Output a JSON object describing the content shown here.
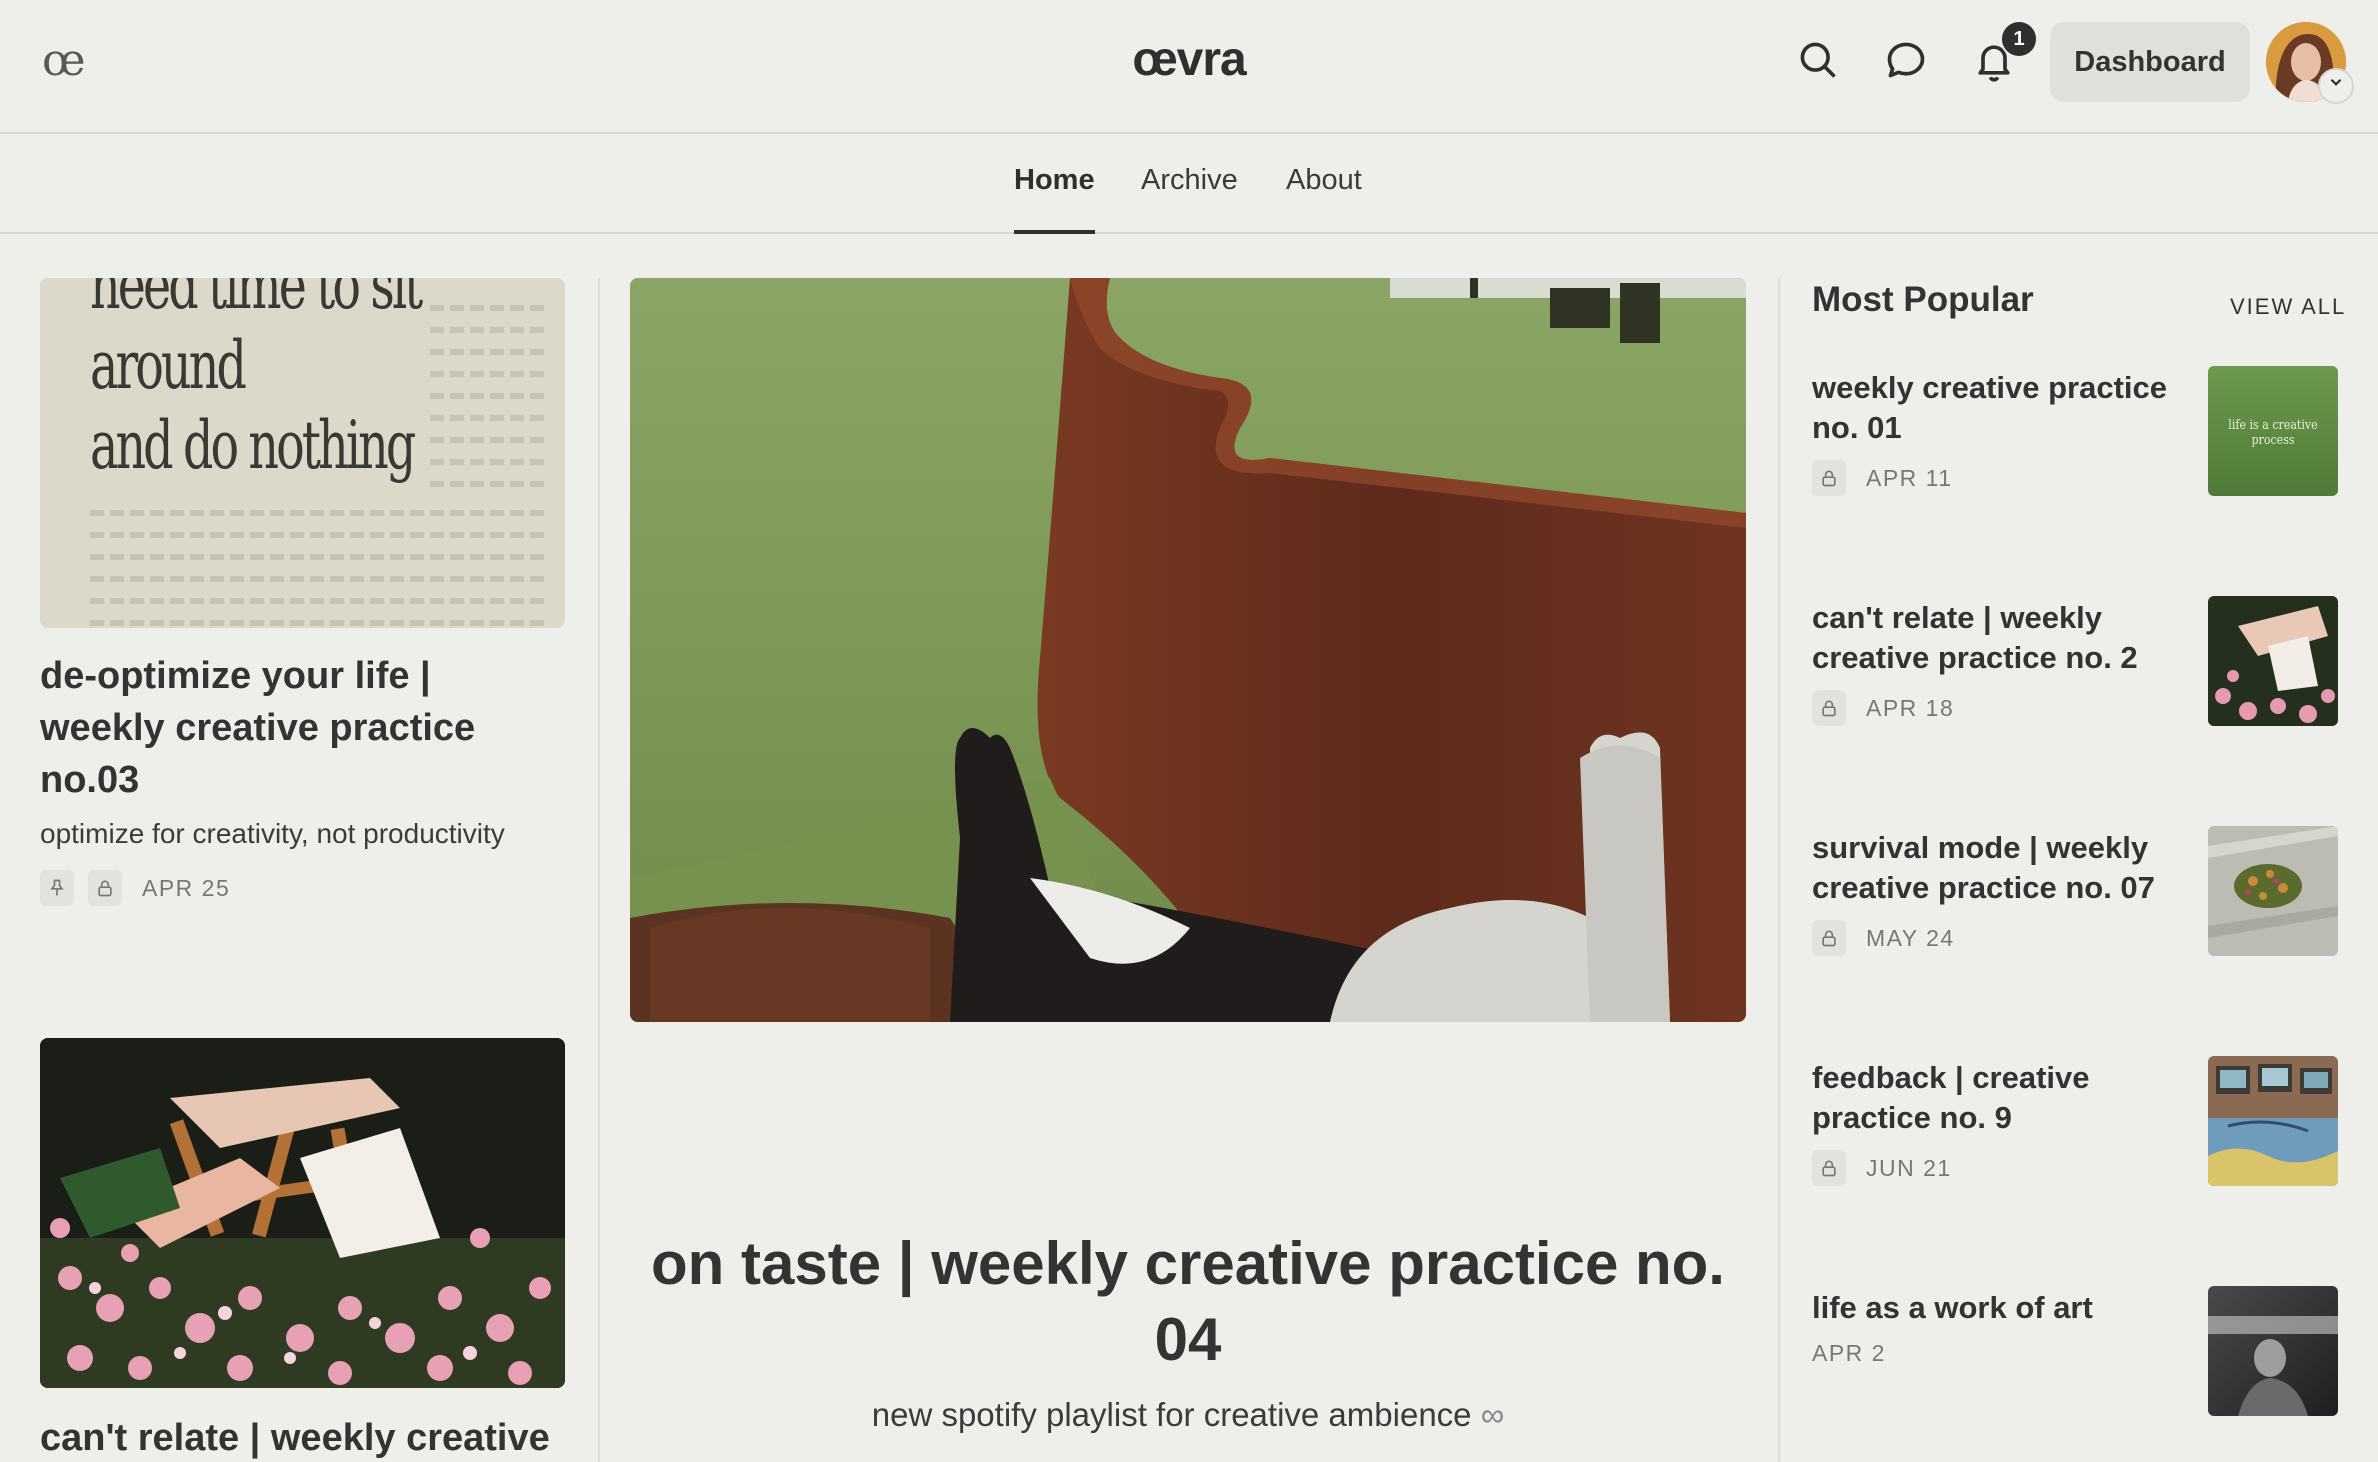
{
  "header": {
    "logo_glyph": "œ",
    "wordmark": "œvra",
    "notification_count": "1",
    "dashboard_label": "Dashboard",
    "icons": [
      "search-icon",
      "chat-icon",
      "bell-icon"
    ]
  },
  "nav": {
    "items": [
      {
        "label": "Home",
        "active": true
      },
      {
        "label": "Archive",
        "active": false
      },
      {
        "label": "About",
        "active": false
      }
    ]
  },
  "left_column": {
    "posts": [
      {
        "image_text": [
          "need time to sit",
          "around",
          "and do nothing"
        ],
        "title": "de-optimize your life | weekly creative practice no.03",
        "subtitle": "optimize for creativity, not productivity",
        "date": "APR 25",
        "pinned": true,
        "locked": true
      },
      {
        "title": "can't relate | weekly creative"
      }
    ]
  },
  "featured": {
    "title": "on taste | weekly creative practice no. 04",
    "subtitle": "new spotify playlist for creative ambience",
    "subtitle_glyph": "∞"
  },
  "sidebar": {
    "heading": "Most Popular",
    "view_all": "VIEW ALL",
    "items": [
      {
        "title": "weekly creative practice no. 01",
        "date": "APR 11",
        "locked": true,
        "thumb_text": "life is a creative process",
        "thumb_colors": [
          "#5d8a45",
          "#9fc27a"
        ]
      },
      {
        "title": "can't relate | weekly creative practice no. 2",
        "date": "APR 18",
        "locked": true,
        "thumb_colors": [
          "#2c3a22",
          "#d98aa0"
        ]
      },
      {
        "title": "survival mode | weekly creative practice no. 07",
        "date": "MAY 24",
        "locked": true,
        "thumb_colors": [
          "#b9b9b2",
          "#6d7b3c"
        ]
      },
      {
        "title": "feedback | creative practice no. 9",
        "date": "JUN 21",
        "locked": true,
        "thumb_colors": [
          "#7c5a44",
          "#6a9ab8"
        ]
      },
      {
        "title": "life as a work of art",
        "date": "APR 2",
        "locked": false,
        "thumb_colors": [
          "#2a2a2a",
          "#bdbdbd"
        ]
      }
    ]
  },
  "colors": {
    "background": "#eeefeb",
    "text": "#333432",
    "badge": "#2f302e",
    "button_bg": "#dfe0dc"
  }
}
